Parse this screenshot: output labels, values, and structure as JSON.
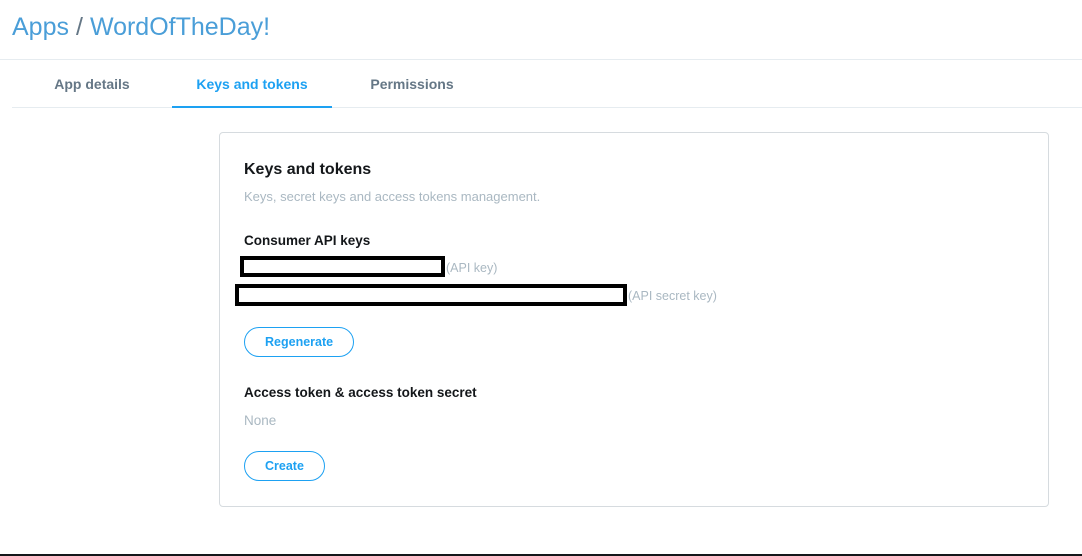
{
  "breadcrumb": {
    "apps": "Apps",
    "separator": "/",
    "app_name": "WordOfTheDay!"
  },
  "tabs": [
    {
      "label": "App details",
      "active": false
    },
    {
      "label": "Keys and tokens",
      "active": true
    },
    {
      "label": "Permissions",
      "active": false
    }
  ],
  "card": {
    "title": "Keys and tokens",
    "subtitle": "Keys, secret keys and access tokens management.",
    "consumer": {
      "title": "Consumer API keys",
      "api_key_label": "(API key)",
      "api_secret_label": "(API secret key)",
      "regenerate_label": "Regenerate"
    },
    "access": {
      "title": "Access token & access token secret",
      "value": "None",
      "create_label": "Create"
    }
  },
  "colors": {
    "accent": "#1da1f2",
    "muted": "#aab8c2",
    "text": "#14171a"
  }
}
